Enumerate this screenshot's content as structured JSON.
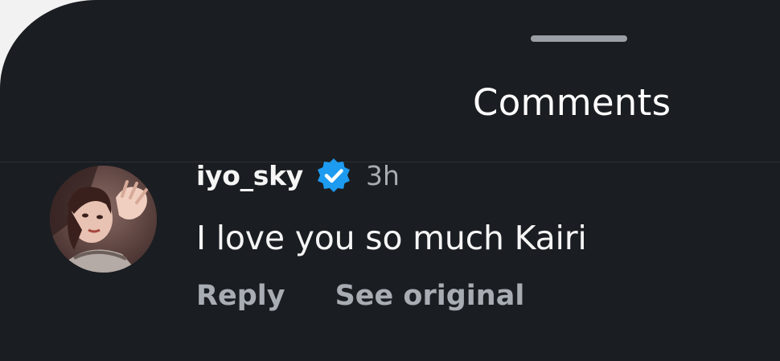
{
  "sheet": {
    "title": "Comments"
  },
  "comment": {
    "username": "iyo_sky",
    "time": "3h",
    "text": "I love you so much Kairi",
    "avatar_icon": "user-avatar",
    "verified_icon": "verified-badge-icon",
    "verified_color": "#1d9bf0",
    "actions": {
      "reply": "Reply",
      "see_original": "See original"
    }
  },
  "colors": {
    "background": "#1a1d21",
    "primary_text": "#f5f5f5",
    "secondary_text": "#a8adb3",
    "handle": "#9aa0a6"
  }
}
